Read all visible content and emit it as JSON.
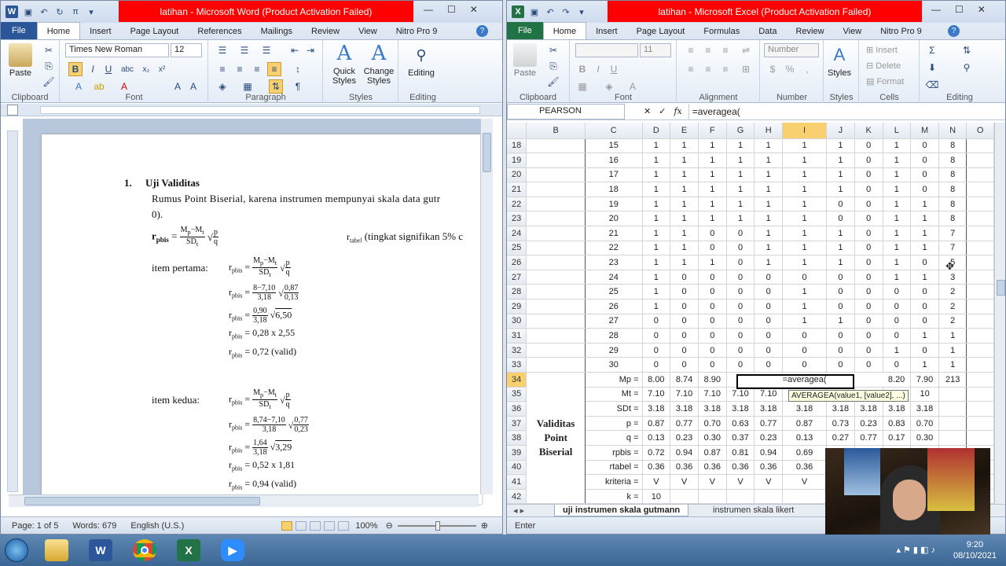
{
  "word": {
    "title": "latihan  -  Microsoft Word (Product Activation Failed)",
    "file_tab": "File",
    "tabs": [
      "Home",
      "Insert",
      "Page Layout",
      "References",
      "Mailings",
      "Review",
      "View",
      "Nitro Pro 9"
    ],
    "font_name": "Times New Roman",
    "font_size": "12",
    "groups": {
      "clipboard": "Clipboard",
      "font": "Font",
      "paragraph": "Paragraph",
      "styles": "Styles",
      "editing": "Editing"
    },
    "buttons": {
      "paste": "Paste",
      "quick_styles": "Quick Styles",
      "change_styles": "Change Styles",
      "editing": "Editing"
    },
    "doc": {
      "heading_num": "1.",
      "heading": "Uji Validitas",
      "intro": "Rumus Point Biserial, karena instrumen mempunyai skala data gutr",
      "intro2": "0).",
      "rtabel_note": "(tingkat signifikan 5% c",
      "item1_label": "item pertama:",
      "item2_label": "item kedua:",
      "item1": {
        "mp": "8",
        "mt": "7,10",
        "sdt": "3,18",
        "p": "0,87",
        "q": "0,13",
        "num": "0,90",
        "root": "6,50",
        "mul": "= 0,28 x 2,55",
        "result": "= 0,72 (valid)"
      },
      "item2": {
        "mp": "8,74",
        "mt": "7,10",
        "sdt": "3,18",
        "p": "0,77",
        "q": "0,23",
        "num": "1,64",
        "root": "3,29",
        "mul": "= 0,52 x 1,81",
        "result": "= 0,94 (valid)"
      }
    },
    "status": {
      "page": "Page: 1 of 5",
      "words": "Words: 679",
      "lang": "English (U.S.)",
      "zoom": "100%"
    }
  },
  "excel": {
    "title": "latihan  -  Microsoft Excel (Product Activation Failed)",
    "file_tab": "File",
    "tabs": [
      "Home",
      "Insert",
      "Page Layout",
      "Formulas",
      "Data",
      "Review",
      "View",
      "Nitro Pro 9"
    ],
    "font_size": "11",
    "number_format": "Number",
    "groups": {
      "clipboard": "Clipboard",
      "font": "Font",
      "alignment": "Alignment",
      "number": "Number",
      "styles": "Styles",
      "cells": "Cells",
      "editing": "Editing"
    },
    "buttons": {
      "paste": "Paste",
      "styles": "Styles",
      "insert": "Insert",
      "delete": "Delete",
      "format": "Format"
    },
    "name_box": "PEARSON",
    "formula": "=averagea(",
    "columns": [
      "B",
      "C",
      "D",
      "E",
      "F",
      "G",
      "H",
      "I",
      "J",
      "K",
      "L",
      "M",
      "N",
      "O"
    ],
    "rows": [
      {
        "r": "18",
        "c": "15",
        "v": [
          "1",
          "1",
          "1",
          "1",
          "1",
          "1",
          "1",
          "0",
          "1",
          "0",
          "8"
        ]
      },
      {
        "r": "19",
        "c": "16",
        "v": [
          "1",
          "1",
          "1",
          "1",
          "1",
          "1",
          "1",
          "0",
          "1",
          "0",
          "8"
        ]
      },
      {
        "r": "20",
        "c": "17",
        "v": [
          "1",
          "1",
          "1",
          "1",
          "1",
          "1",
          "1",
          "0",
          "1",
          "0",
          "8"
        ]
      },
      {
        "r": "21",
        "c": "18",
        "v": [
          "1",
          "1",
          "1",
          "1",
          "1",
          "1",
          "1",
          "0",
          "1",
          "0",
          "8"
        ]
      },
      {
        "r": "22",
        "c": "19",
        "v": [
          "1",
          "1",
          "1",
          "1",
          "1",
          "1",
          "0",
          "0",
          "1",
          "1",
          "8"
        ]
      },
      {
        "r": "23",
        "c": "20",
        "v": [
          "1",
          "1",
          "1",
          "1",
          "1",
          "1",
          "0",
          "0",
          "1",
          "1",
          "8"
        ]
      },
      {
        "r": "24",
        "c": "21",
        "v": [
          "1",
          "1",
          "0",
          "0",
          "1",
          "1",
          "1",
          "0",
          "1",
          "1",
          "7"
        ]
      },
      {
        "r": "25",
        "c": "22",
        "v": [
          "1",
          "1",
          "0",
          "0",
          "1",
          "1",
          "1",
          "0",
          "1",
          "1",
          "7"
        ]
      },
      {
        "r": "26",
        "c": "23",
        "v": [
          "1",
          "1",
          "1",
          "0",
          "1",
          "1",
          "1",
          "0",
          "1",
          "0",
          "5"
        ]
      },
      {
        "r": "27",
        "c": "24",
        "v": [
          "1",
          "0",
          "0",
          "0",
          "0",
          "0",
          "0",
          "0",
          "1",
          "1",
          "3"
        ]
      },
      {
        "r": "28",
        "c": "25",
        "v": [
          "1",
          "0",
          "0",
          "0",
          "0",
          "1",
          "0",
          "0",
          "0",
          "0",
          "2"
        ]
      },
      {
        "r": "29",
        "c": "26",
        "v": [
          "1",
          "0",
          "0",
          "0",
          "0",
          "1",
          "0",
          "0",
          "0",
          "0",
          "2"
        ]
      },
      {
        "r": "30",
        "c": "27",
        "v": [
          "0",
          "0",
          "0",
          "0",
          "0",
          "1",
          "1",
          "0",
          "0",
          "0",
          "2"
        ]
      },
      {
        "r": "31",
        "c": "28",
        "v": [
          "0",
          "0",
          "0",
          "0",
          "0",
          "0",
          "0",
          "0",
          "0",
          "1",
          "1"
        ]
      },
      {
        "r": "32",
        "c": "29",
        "v": [
          "0",
          "0",
          "0",
          "0",
          "0",
          "0",
          "0",
          "0",
          "1",
          "0",
          "1"
        ]
      },
      {
        "r": "33",
        "c": "30",
        "v": [
          "0",
          "0",
          "0",
          "0",
          "0",
          "0",
          "0",
          "0",
          "0",
          "1",
          "1"
        ]
      }
    ],
    "stat_rows": [
      {
        "r": "34",
        "label": "Mp =",
        "v": [
          "8.00",
          "8.74",
          "8.90",
          "",
          "",
          "=averagea(",
          "",
          "",
          "8.20",
          "7.90",
          "213"
        ]
      },
      {
        "r": "35",
        "label": "Mt =",
        "v": [
          "7.10",
          "7.10",
          "7.10",
          "7.10",
          "7.10",
          "",
          "",
          "",
          "",
          "10",
          ""
        ]
      },
      {
        "r": "36",
        "label": "SDt =",
        "v": [
          "3.18",
          "3.18",
          "3.18",
          "3.18",
          "3.18",
          "3.18",
          "3.18",
          "3.18",
          "3.18",
          "3.18",
          ""
        ]
      },
      {
        "r": "37",
        "label": "p =",
        "v": [
          "0.87",
          "0.77",
          "0.70",
          "0.63",
          "0.77",
          "0.87",
          "0.73",
          "0.23",
          "0.83",
          "0.70",
          ""
        ]
      },
      {
        "r": "38",
        "label": "q =",
        "v": [
          "0.13",
          "0.23",
          "0.30",
          "0.37",
          "0.23",
          "0.13",
          "0.27",
          "0.77",
          "0.17",
          "0.30",
          ""
        ]
      },
      {
        "r": "39",
        "label": "rpbis =",
        "v": [
          "0.72",
          "0.94",
          "0.87",
          "0.81",
          "0.94",
          "0.69",
          "",
          "",
          "",
          "",
          ""
        ]
      },
      {
        "r": "40",
        "label": "rtabel =",
        "v": [
          "0.36",
          "0.36",
          "0.36",
          "0.36",
          "0.36",
          "0.36",
          "",
          "",
          "",
          "",
          ""
        ]
      },
      {
        "r": "41",
        "label": "kriteria =",
        "v": [
          "V",
          "V",
          "V",
          "V",
          "V",
          "V",
          "",
          "",
          "",
          "",
          ""
        ]
      },
      {
        "r": "42",
        "label": "k =",
        "v": [
          "10",
          "",
          "",
          "",
          "",
          "",
          "",
          "",
          "",
          "",
          ""
        ]
      }
    ],
    "side_label": "Validitas Point Biserial",
    "tooltip": "AVERAGEA(value1, [value2], ...)",
    "sheet_tabs": [
      "uji instrumen skala gutmann",
      "instrumen skala likert"
    ],
    "mode": "Enter"
  },
  "taskbar": {
    "time": "9:20",
    "date": "08/10/2021"
  },
  "colors": {
    "word_blue": "#2b579a",
    "excel_green": "#217346",
    "title_red": "#ff0000"
  }
}
